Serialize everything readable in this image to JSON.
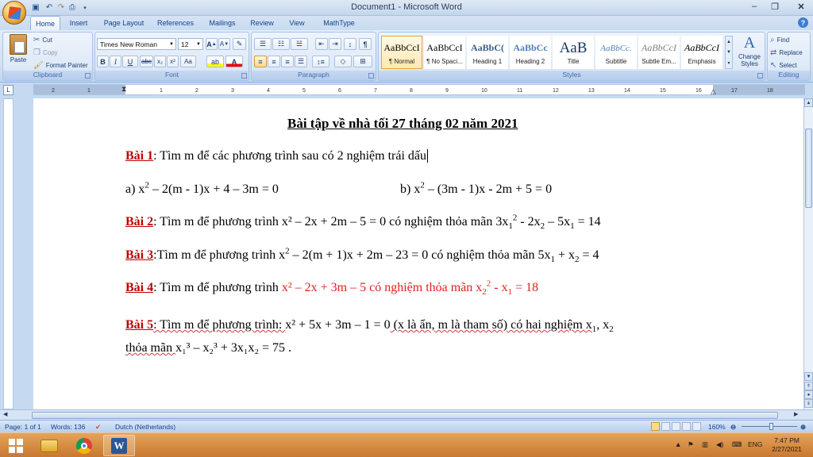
{
  "window": {
    "title": "Document1 - Microsoft Word",
    "minimize_glyph": "–",
    "restore_glyph": "❐",
    "close_glyph": "✕"
  },
  "ribbon_tabs": [
    "Home",
    "Insert",
    "Page Layout",
    "References",
    "Mailings",
    "Review",
    "View",
    "MathType"
  ],
  "active_tab": "Home",
  "clipboard": {
    "paste": "Paste",
    "cut": "Cut",
    "copy": "Copy",
    "format_painter": "Format Painter",
    "label": "Clipboard"
  },
  "font": {
    "name": "Times New Roman",
    "size": "12",
    "label": "Font"
  },
  "paragraph": {
    "label": "Paragraph"
  },
  "styles": {
    "label": "Styles",
    "items": [
      {
        "sample": "AaBbCcI",
        "name": "¶ Normal"
      },
      {
        "sample": "AaBbCcI",
        "name": "¶ No Spaci..."
      },
      {
        "sample": "AaBbC(",
        "name": "Heading 1"
      },
      {
        "sample": "AaBbCc",
        "name": "Heading 2"
      },
      {
        "sample": "AaB",
        "name": "Title"
      },
      {
        "sample": "AaBbCc.",
        "name": "Subtitle"
      },
      {
        "sample": "AaBbCcI",
        "name": "Subtle Em..."
      },
      {
        "sample": "AaBbCcI",
        "name": "Emphasis"
      }
    ],
    "change_styles": "Change Styles"
  },
  "editing": {
    "label": "Editing",
    "find": "Find",
    "replace": "Replace",
    "select": "Select"
  },
  "ruler_numbers": [
    "2",
    "1",
    "1",
    "2",
    "3",
    "4",
    "5",
    "6",
    "7",
    "8",
    "9",
    "10",
    "11",
    "12",
    "13",
    "14",
    "15",
    "16",
    "17",
    "18"
  ],
  "document": {
    "heading": "Bài tập về nhà tối 27 tháng 02 năm 2021",
    "b1_label": "Bài 1",
    "b1_text": ": Tìm m để các phương trình sau có 2 nghiệm trái dấu",
    "b1_a": "a) x",
    "b1_a_rest": " – 2(m - 1)x + 4 – 3m = 0",
    "b1_b": "b) x",
    "b1_b_rest": " – (3m - 1)x  - 2m + 5 = 0",
    "b2_label": "Bài 2",
    "b2_text": ": Tìm m để phương trình  x² – 2x + 2m – 5 = 0 có nghiệm thỏa mãn 3x",
    "b2_tail": " - 2x",
    "b2_tail2": " – 5x",
    "b2_end": " = 14",
    "b3_label": "Bài 3",
    "b3_text": ":Tìm m để phương trình x",
    "b3_mid": " – 2(m + 1)x + 2m – 23 = 0 có nghiệm  thỏa mãn 5x",
    "b3_mid2": " + x",
    "b3_end": " = 4",
    "b4_label": "Bài 4",
    "b4_text": ": Tìm m để phương trình  ",
    "b4_red": "x² – 2x + 3m – 5 có nghiệm thỏa mãn  x",
    "b4_red_end": " - x",
    "b4_red_end2": " = 18",
    "b5_label": "Bài 5",
    "b5_text": ": Tìm m để phương trình: ",
    "b5_eq": " x² + 5x + 3m – 1 = 0",
    "b5_rest": "  (x là ẩn, m là tham số) có hai nghiệm x",
    "b5_rest2": ", x",
    "b5_line2": "thỏa mãn ",
    "b5_line2_eq": " x₁³ – x₂³ + 3x₁x₂ = 75",
    "b5_line2_end": " .",
    "sup2": "2",
    "sub1": "1",
    "sub2": "2"
  },
  "status": {
    "page": "Page: 1 of 1",
    "words": "Words: 136",
    "language": "Dutch (Netherlands)",
    "zoom": "160%"
  },
  "taskbar": {
    "lang": "ENG",
    "time": "7:47 PM",
    "date": "2/27/2021"
  }
}
